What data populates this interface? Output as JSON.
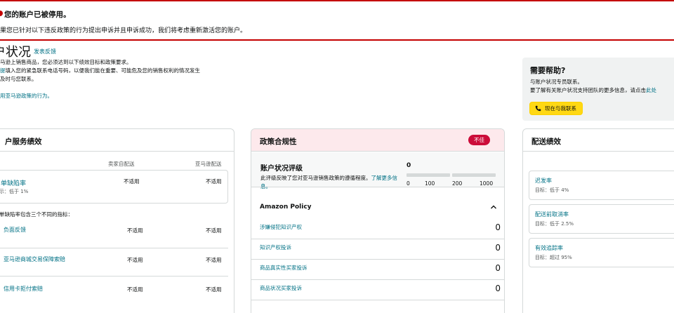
{
  "banner": {
    "title": "您的账户已被停用。",
    "text": "果您已针对以下违反政策的行为提出申诉并且申诉成功，我们将考虑重新激活您的账户。"
  },
  "header": {
    "title": "户状况",
    "feedback_link": "发表反馈",
    "desc_lines": [
      "马逊上销售商品，您必须达到以下绩效目标和政策要求。",
      "提填入您的紧急联系电话号码，以便我们能在重要、可能危及您的销售权利的情况发生",
      "及时与您联系。"
    ],
    "desc_line2_link": "提",
    "policy_link": "用亚马逊政策的行为。"
  },
  "help": {
    "title": "需要帮助?",
    "line1": "与账户状况专员联系。",
    "line2": "要了解有关账户状况支持团队的更多信息，请点击",
    "line2_link": "此处",
    "contact_button": "现在与我联系"
  },
  "service_card": {
    "title": "户服务绩效",
    "col_seller": "卖家自配送",
    "col_amazon": "亚马逊配送",
    "odr": {
      "label": "单缺陷率",
      "target": "示：低于 1%",
      "seller": "不适用",
      "amazon": "不适用"
    },
    "sub_heading": "单缺陷率包含三个不同的指标：",
    "rows": [
      {
        "label": "负面反馈",
        "seller": "不适用",
        "amazon": "不适用"
      },
      {
        "label": "亚马逊商城交易保障索赔",
        "seller": "不适用",
        "amazon": "不适用"
      },
      {
        "label": "信用卡拒付索赔",
        "seller": "不适用",
        "amazon": "不适用"
      }
    ]
  },
  "compliance_card": {
    "title": "政策合规性",
    "badge": "不佳",
    "score_title": "账户状况评级",
    "score_desc": "此评级反映了您对亚马逊销售政策的遵循程度。",
    "score_desc_link": "了解更多信息。",
    "score_value": "0",
    "scale_ticks": [
      "0",
      "100",
      "200",
      "1000"
    ],
    "section_title": "Amazon Policy",
    "policy_rows": [
      {
        "label": "涉嫌侵犯知识产权",
        "value": "0"
      },
      {
        "label": "知识产权投诉",
        "value": "0"
      },
      {
        "label": "商品真实性买家投诉",
        "value": "0"
      },
      {
        "label": "商品状况买家投诉",
        "value": "0"
      }
    ]
  },
  "delivery_card": {
    "title": "配送绩效",
    "metrics": [
      {
        "label": "迟发率",
        "target": "目标：低于 4%"
      },
      {
        "label": "配送前取消率",
        "target": "目标：低于 2.5%"
      },
      {
        "label": "有效追踪率",
        "target": "目标：超过 95%"
      }
    ]
  },
  "colors": {
    "accent_red": "#c40000",
    "badge_red": "#cc0c39",
    "link": "#007185",
    "button_yellow": "#ffd814"
  },
  "icons": {
    "warning": "alert-icon",
    "contact": "phone-icon",
    "collapse": "chevron-up-icon"
  }
}
